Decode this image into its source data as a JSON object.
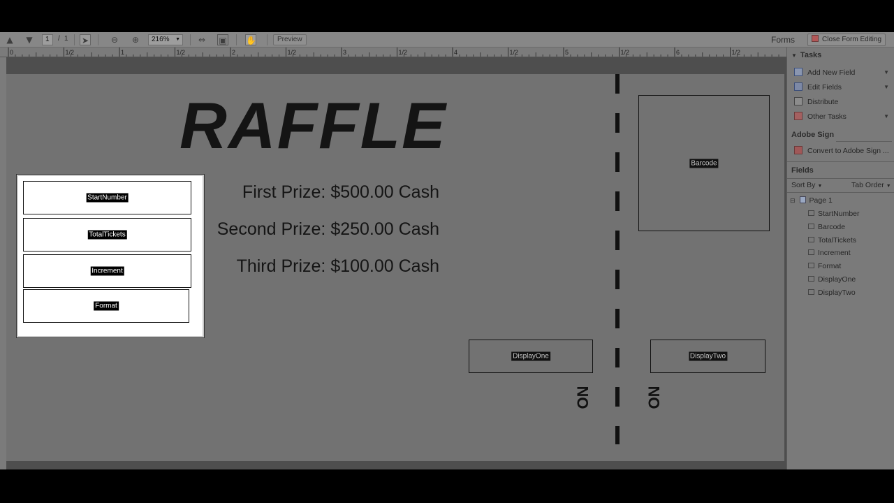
{
  "toolbar": {
    "page_current": "1",
    "page_sep": "/",
    "page_total": "1",
    "zoom": "216%",
    "preview_label": "Preview",
    "forms_label": "Forms",
    "close_form_editing": "Close Form Editing"
  },
  "ruler": {
    "marks": [
      "0",
      "1/2",
      "1",
      "1/2",
      "2",
      "1/2",
      "3",
      "1/2",
      "4",
      "1/2",
      "5",
      "1/2",
      "6",
      "1/2"
    ]
  },
  "document": {
    "title": "RAFFLE",
    "prizes": [
      "First Prize: $500.00 Cash",
      "Second Prize: $250.00 Cash",
      "Third Prize: $100.00 Cash"
    ],
    "number_mark": "NO",
    "fields": {
      "start_number": "StartNumber",
      "total_tickets": "TotalTickets",
      "increment": "Increment",
      "format": "Format",
      "barcode": "Barcode",
      "display_one": "DisplayOne",
      "display_two": "DisplayTwo"
    }
  },
  "panel": {
    "tasks_header": "Tasks",
    "tasks": [
      {
        "label": "Add New Field",
        "icon": "add-field-icon",
        "dropdown": true
      },
      {
        "label": "Edit Fields",
        "icon": "edit-fields-icon",
        "dropdown": true
      },
      {
        "label": "Distribute",
        "icon": "distribute-icon",
        "dropdown": false
      },
      {
        "label": "Other Tasks",
        "icon": "other-tasks-icon",
        "dropdown": true
      }
    ],
    "adobe_sign_header": "Adobe Sign",
    "adobe_sign_item": "Convert to Adobe Sign ...",
    "fields_header": "Fields",
    "sort_by": "Sort By",
    "tab_order": "Tab Order",
    "page_node": "Page 1",
    "field_list": [
      "StartNumber",
      "Barcode",
      "TotalTickets",
      "Increment",
      "Format",
      "DisplayOne",
      "DisplayTwo"
    ]
  },
  "colors": {
    "page_gray": "#727272",
    "panel_gray": "#7a7a7a",
    "accent_red": "#b25757"
  }
}
